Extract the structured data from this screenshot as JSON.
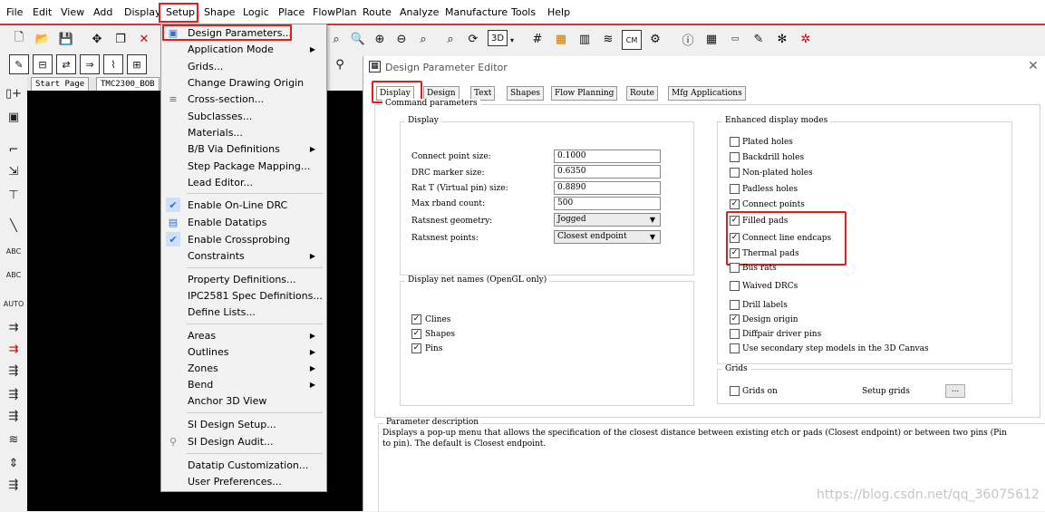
{
  "menubar": {
    "items": [
      "File",
      "Edit",
      "View",
      "Add",
      "Display",
      "Setup",
      "Shape",
      "Logic",
      "Place",
      "FlowPlan",
      "Route",
      "Analyze",
      "Manufacture",
      "Tools",
      "Help"
    ]
  },
  "page_tabs": [
    "Start Page",
    "TMC2300_BOB"
  ],
  "setup_menu": {
    "items": [
      {
        "label": "Design Parameters...",
        "submenu": false
      },
      {
        "label": "Application Mode",
        "submenu": true
      },
      {
        "label": "Grids...",
        "submenu": false
      },
      {
        "label": "Change Drawing Origin",
        "submenu": false
      },
      {
        "label": "Cross-section...",
        "submenu": false
      },
      {
        "label": "Subclasses...",
        "submenu": false
      },
      {
        "label": "Materials...",
        "submenu": false
      },
      {
        "label": "B/B Via Definitions",
        "submenu": true
      },
      {
        "label": "Step Package Mapping...",
        "submenu": false
      },
      {
        "label": "Lead Editor...",
        "submenu": false
      },
      {
        "label": "Enable On-Line DRC",
        "submenu": false
      },
      {
        "label": "Enable Datatips",
        "submenu": false
      },
      {
        "label": "Enable Crossprobing",
        "submenu": false
      },
      {
        "label": "Constraints",
        "submenu": true
      },
      {
        "label": "Property Definitions...",
        "submenu": false
      },
      {
        "label": "IPC2581 Spec Definitions...",
        "submenu": false
      },
      {
        "label": "Define Lists...",
        "submenu": false
      },
      {
        "label": "Areas",
        "submenu": true
      },
      {
        "label": "Outlines",
        "submenu": true
      },
      {
        "label": "Zones",
        "submenu": true
      },
      {
        "label": "Bend",
        "submenu": true
      },
      {
        "label": "Anchor 3D View",
        "submenu": false
      },
      {
        "label": "SI Design Setup...",
        "submenu": false
      },
      {
        "label": "SI Design Audit...",
        "submenu": false
      },
      {
        "label": "Datatip Customization...",
        "submenu": false
      },
      {
        "label": "User Preferences...",
        "submenu": false
      }
    ]
  },
  "dialog": {
    "title": "Design Parameter Editor",
    "tabs": [
      "Display",
      "Design",
      "Text",
      "Shapes",
      "Flow Planning",
      "Route",
      "Mfg Applications"
    ],
    "command_params_title": "Command parameters",
    "display_group": {
      "title": "Display",
      "fields": [
        {
          "label": "Connect point size:",
          "value": "0.1000"
        },
        {
          "label": "DRC marker size:",
          "value": "0.6350"
        },
        {
          "label": "Rat T (Virtual pin) size:",
          "value": "0.8890"
        },
        {
          "label": "Max rband count:",
          "value": "500"
        },
        {
          "label": "Ratsnest geometry:",
          "value": "Jogged"
        },
        {
          "label": "Ratsnest points:",
          "value": "Closest endpoint"
        }
      ]
    },
    "net_names_group": {
      "title": "Display net names (OpenGL only)",
      "items": [
        {
          "label": "Clines",
          "checked": true
        },
        {
          "label": "Shapes",
          "checked": true
        },
        {
          "label": "Pins",
          "checked": true
        }
      ]
    },
    "enhanced_group": {
      "title": "Enhanced display modes",
      "items": [
        {
          "label": "Plated holes",
          "checked": false
        },
        {
          "label": "Backdrill holes",
          "checked": false
        },
        {
          "label": "Non-plated holes",
          "checked": false
        },
        {
          "label": "Padless holes",
          "checked": false
        },
        {
          "label": "Connect points",
          "checked": true
        },
        {
          "label": "Filled pads",
          "checked": true
        },
        {
          "label": "Connect line endcaps",
          "checked": true
        },
        {
          "label": "Thermal pads",
          "checked": true
        },
        {
          "label": "Bus rats",
          "checked": false
        },
        {
          "label": "Waived DRCs",
          "checked": false
        },
        {
          "label": "Drill labels",
          "checked": false
        },
        {
          "label": "Design origin",
          "checked": true
        },
        {
          "label": "Diffpair driver pins",
          "checked": false
        },
        {
          "label": "Use secondary step models in the 3D Canvas",
          "checked": false
        }
      ]
    },
    "grids_group": {
      "title": "Grids",
      "grids_on": "Grids on",
      "setup_grids": "Setup grids",
      "button": "..."
    },
    "param_desc": {
      "title": "Parameter description",
      "text": "Displays a pop-up menu that allows the specification of the closest distance between existing etch or pads (Closest endpoint) or between two pins (Pin to pin). The default is Closest endpoint."
    }
  },
  "watermark": "https://blog.csdn.net/qq_36075612",
  "colors": {
    "highlight": "#e01e1e",
    "accent": "#2f6fd6"
  }
}
